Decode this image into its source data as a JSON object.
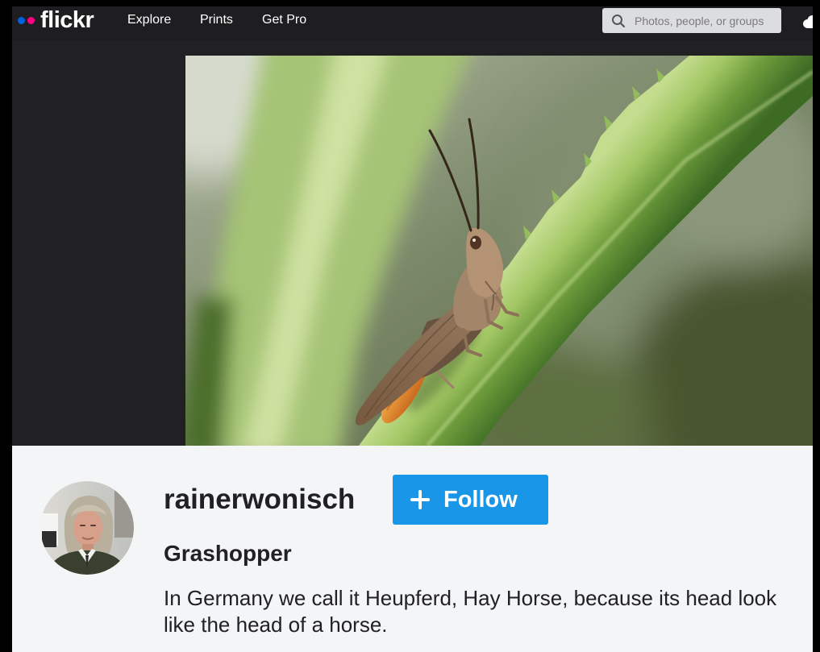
{
  "header": {
    "logo": {
      "text": "flickr",
      "dot_colors": [
        "#0063dc",
        "#ff0084"
      ]
    },
    "nav": [
      {
        "label": "Explore"
      },
      {
        "label": "Prints"
      },
      {
        "label": "Get Pro"
      }
    ],
    "search": {
      "placeholder": "Photos, people, or groups",
      "icon": "search-icon"
    },
    "upload_icon": "cloud-upload-icon"
  },
  "owner": {
    "username": "rainerwonisch"
  },
  "follow_button": {
    "label": "Follow",
    "icon": "plus-icon"
  },
  "photo_info": {
    "title": "Grashopper",
    "description": "In Germany we call it Heupferd, Hay Horse, because its head look like the head of a horse."
  },
  "colors": {
    "nav_background": "#1e1e21",
    "page_background": "#212124",
    "info_background": "#f3f5f6",
    "follow_button": "#1a96e8",
    "text": "#212124"
  }
}
